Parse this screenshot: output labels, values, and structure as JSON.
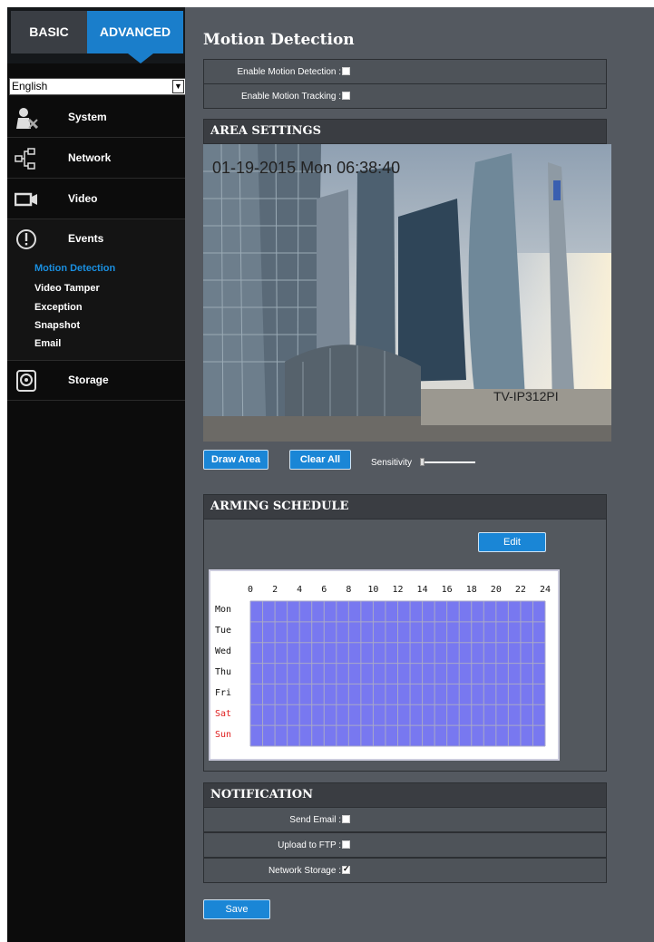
{
  "sidebar": {
    "tabs": {
      "basic": "BASIC",
      "advanced": "ADVANCED"
    },
    "language": "English",
    "items": [
      {
        "label": "System",
        "icon": "system-icon"
      },
      {
        "label": "Network",
        "icon": "network-icon"
      },
      {
        "label": "Video",
        "icon": "video-icon"
      },
      {
        "label": "Events",
        "icon": "events-icon"
      },
      {
        "label": "Storage",
        "icon": "storage-icon"
      }
    ],
    "events_sub": [
      {
        "label": "Motion Detection",
        "active": true
      },
      {
        "label": "Video Tamper",
        "active": false
      },
      {
        "label": "Exception",
        "active": false
      },
      {
        "label": "Snapshot",
        "active": false
      },
      {
        "label": "Email",
        "active": false
      }
    ]
  },
  "main": {
    "title": "Motion Detection",
    "enable_motion_detection": {
      "label": "Enable Motion Detection :",
      "checked": false
    },
    "enable_motion_tracking": {
      "label": "Enable Motion Tracking :",
      "checked": false
    },
    "area_settings": {
      "header": "AREA SETTINGS",
      "timestamp": "01-19-2015 Mon  06:38:40",
      "camera_name": "TV-IP312PI",
      "draw_area": "Draw Area",
      "clear_all": "Clear All",
      "sensitivity": "Sensitivity"
    },
    "arming_schedule": {
      "header": "ARMING SCHEDULE",
      "edit": "Edit",
      "hours": [
        "0",
        "2",
        "4",
        "6",
        "8",
        "10",
        "12",
        "14",
        "16",
        "18",
        "20",
        "22",
        "24"
      ],
      "days": [
        "Mon",
        "Tue",
        "Wed",
        "Thu",
        "Fri",
        "Sat",
        "Sun"
      ]
    },
    "notification": {
      "header": "NOTIFICATION",
      "send_email": {
        "label": "Send Email :",
        "checked": false
      },
      "upload_ftp": {
        "label": "Upload to FTP :",
        "checked": false
      },
      "network_storage": {
        "label": "Network Storage :",
        "checked": true
      }
    },
    "save": "Save"
  },
  "colors": {
    "accent": "#1a86d6",
    "panel": "#545960",
    "sidebar": "#0c0c0c",
    "schedule_fill": "#7878f0",
    "weekend": "#e02020"
  }
}
